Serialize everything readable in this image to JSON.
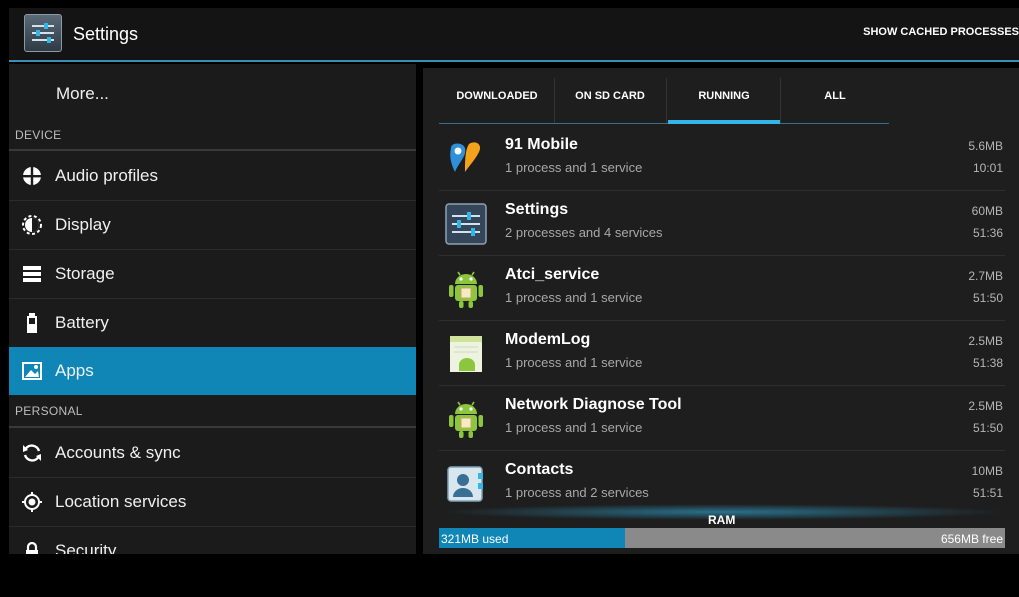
{
  "action_bar": {
    "title": "Settings",
    "show_cached_label": "SHOW CACHED PROCESSES"
  },
  "left_pane": {
    "more_label": "More...",
    "device_header": "DEVICE",
    "device_items": [
      {
        "label": "Audio profiles",
        "icon": "audio-profiles-icon"
      },
      {
        "label": "Display",
        "icon": "display-icon"
      },
      {
        "label": "Storage",
        "icon": "storage-icon"
      },
      {
        "label": "Battery",
        "icon": "battery-icon"
      },
      {
        "label": "Apps",
        "icon": "apps-icon",
        "selected": true
      }
    ],
    "personal_header": "PERSONAL",
    "personal_items": [
      {
        "label": "Accounts & sync",
        "icon": "sync-icon"
      },
      {
        "label": "Location services",
        "icon": "location-icon"
      },
      {
        "label": "Security",
        "icon": "lock-icon"
      }
    ]
  },
  "tabs": [
    {
      "label": "DOWNLOADED"
    },
    {
      "label": "ON SD CARD"
    },
    {
      "label": "RUNNING",
      "selected": true
    },
    {
      "label": "ALL"
    }
  ],
  "processes": [
    {
      "name": "91 Mobile",
      "detail": "1 process and 1 service",
      "size": "5.6MB",
      "time": "10:01",
      "icon": "91-mobile-icon"
    },
    {
      "name": "Settings",
      "detail": "2 processes and 4 services",
      "size": "60MB",
      "time": "51:36",
      "icon": "settings-icon"
    },
    {
      "name": "Atci_service",
      "detail": "1 process and 1 service",
      "size": "2.7MB",
      "time": "51:50",
      "icon": "android-icon"
    },
    {
      "name": "ModemLog",
      "detail": "1 process and 1 service",
      "size": "2.5MB",
      "time": "51:38",
      "icon": "modemlog-icon"
    },
    {
      "name": "Network Diagnose Tool",
      "detail": "1 process and 1 service",
      "size": "2.5MB",
      "time": "51:50",
      "icon": "android-icon"
    },
    {
      "name": "Contacts",
      "detail": "1 process and 2 services",
      "size": "10MB",
      "time": "51:51",
      "icon": "contacts-icon"
    }
  ],
  "ram": {
    "label": "RAM",
    "used": "321MB used",
    "free": "656MB free",
    "used_fraction": 0.329
  },
  "colors": {
    "accent": "#33b5e5",
    "selected": "#0f86b6"
  }
}
